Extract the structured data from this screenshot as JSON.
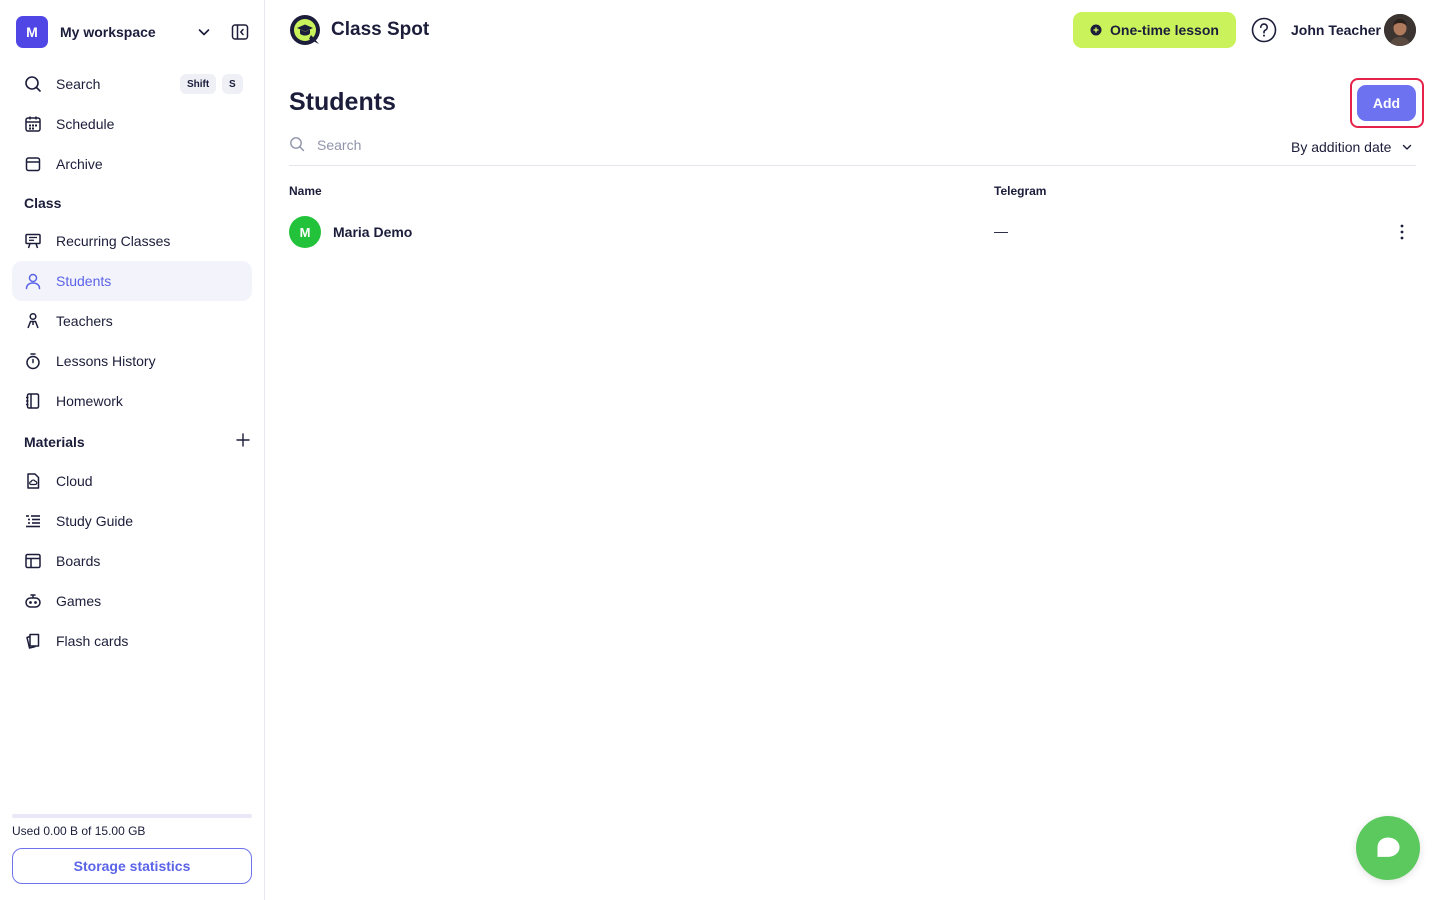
{
  "workspace": {
    "avatar_letter": "M",
    "name": "My workspace"
  },
  "sidebar": {
    "search": {
      "label": "Search",
      "shortcut_1": "Shift",
      "shortcut_2": "S"
    },
    "items_top": [
      {
        "label": "Schedule",
        "icon": "calendar-icon"
      },
      {
        "label": "Archive",
        "icon": "archive-icon"
      }
    ],
    "section_class": "Class",
    "class_items": [
      {
        "label": "Recurring Classes",
        "icon": "presentation-icon"
      },
      {
        "label": "Students",
        "icon": "user-icon",
        "active": true
      },
      {
        "label": "Teachers",
        "icon": "teacher-icon"
      },
      {
        "label": "Lessons History",
        "icon": "stopwatch-icon"
      },
      {
        "label": "Homework",
        "icon": "notebook-icon"
      }
    ],
    "section_materials": "Materials",
    "material_items": [
      {
        "label": "Cloud",
        "icon": "cloud-file-icon"
      },
      {
        "label": "Study Guide",
        "icon": "list-icon"
      },
      {
        "label": "Boards",
        "icon": "board-icon"
      },
      {
        "label": "Games",
        "icon": "gamepad-icon"
      },
      {
        "label": "Flash cards",
        "icon": "cards-icon"
      }
    ],
    "storage": {
      "used_text": "Used 0.00 B of 15.00 GB",
      "button_label": "Storage statistics",
      "used_fraction": 0.0
    }
  },
  "header": {
    "brand": "Class Spot",
    "one_time_lesson": "One-time lesson",
    "user_name": "John Teacher"
  },
  "main": {
    "title": "Students",
    "add_label": "Add",
    "search_placeholder": "Search",
    "sort_label": "By addition date",
    "columns": {
      "name": "Name",
      "telegram": "Telegram"
    },
    "rows": [
      {
        "initial": "M",
        "name": "Maria Demo",
        "telegram": "—"
      }
    ]
  },
  "colors": {
    "accent": "#6c72f0",
    "lime": "#c9f25b",
    "avatar_green": "#22c23a",
    "chat_green": "#5bc95d",
    "highlight_red": "#e5234a"
  }
}
